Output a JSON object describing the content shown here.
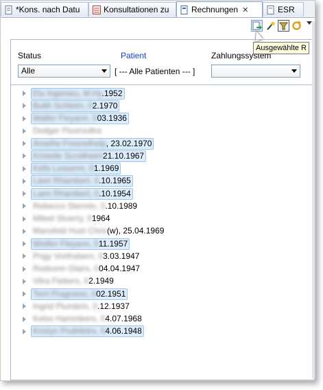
{
  "tabs": [
    {
      "label": "*Kons. nach Datu",
      "icon": "document-icon",
      "active": false
    },
    {
      "label": "Konsultationen zu",
      "icon": "list-icon",
      "active": false
    },
    {
      "label": "Rechnungen",
      "icon": "document-icon",
      "active": true
    },
    {
      "label": "ESR",
      "icon": "document-icon",
      "active": false
    }
  ],
  "tooltip": "Ausgewählte R",
  "filters": {
    "status_label": "Status",
    "status_value": "Alle",
    "patient_label": "Patient",
    "patient_value": "[ --- Alle Patienten --- ]",
    "payment_label": "Zahlungssystem",
    "payment_value": ""
  },
  "tree_rows": [
    {
      "name": "Elu Ingenieu, M.Hy",
      "date": ".1952"
    },
    {
      "name": "Bulth Schleim, 0",
      "date": "2.1970"
    },
    {
      "name": "Walfer Fleyann, 0",
      "date": "03.1936"
    },
    {
      "name": "Dodger Fluoroultra",
      "date": ""
    },
    {
      "name": "Amelhe Fresnelhelp",
      "date": ", 23.02.1970"
    },
    {
      "name": "Kristelle Scrollheim",
      "date": "21.10.1967"
    },
    {
      "name": "Kells Leasenn, 0",
      "date": "1.1969"
    },
    {
      "name": "Laen Rhambert, 0",
      "date": ".10.1965"
    },
    {
      "name": "Laen Rhambert, 0",
      "date": ".10.1954"
    },
    {
      "name": "Rebecco Stermlo, 0",
      "date": ".10.1989"
    },
    {
      "name": "Mileel Stuerry, 0",
      "date": "1964"
    },
    {
      "name": "Mansfeld Hust Chris",
      "date": "(w), 25.04.1969"
    },
    {
      "name": "Weiller Fleyann, 0",
      "date": "11.1957"
    },
    {
      "name": "Prigy Vorthsbern, 0",
      "date": "3.03.1947"
    },
    {
      "name": "Rodsonn Glairs, 0",
      "date": "04.04.1947"
    },
    {
      "name": "Vitra Fiebers, 0",
      "date": "2.1949"
    },
    {
      "name": "Terri Pragneon, 0",
      "date": "02.1951"
    },
    {
      "name": "Ingrid Plumbrin, 0",
      "date": ".12.1937"
    },
    {
      "name": "Kelso Hammbers, 0",
      "date": "4.07.1968"
    },
    {
      "name": "Kristyn Pruthfetrs, 0",
      "date": "4.06.1948"
    }
  ],
  "colors": {
    "accent": "#9fc6ef",
    "patient_link": "#1a3dc8",
    "tab_border": "#8aa2c2"
  }
}
